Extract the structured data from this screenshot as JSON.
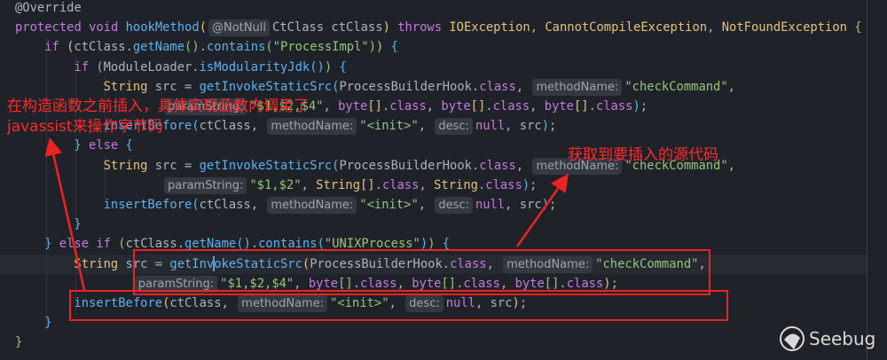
{
  "code_lines": [
    {
      "indent": 0,
      "tokens": [
        [
          "@Override",
          "ann"
        ]
      ]
    },
    {
      "indent": 0,
      "tokens": [
        [
          "protected void ",
          "kw"
        ],
        [
          "hookMethod",
          "fn"
        ],
        [
          "(",
          "p1"
        ],
        [
          "@NotNull",
          "hint"
        ],
        [
          "CtClass ctClass",
          ""
        ],
        [
          ")",
          "p1"
        ],
        [
          " throws ",
          "kw"
        ],
        [
          "IOException",
          "ty"
        ],
        [
          ", ",
          ""
        ],
        [
          "CannotCompileException",
          "ty"
        ],
        [
          ", ",
          ""
        ],
        [
          "NotFoundException",
          "ty"
        ],
        [
          " {",
          "p2"
        ]
      ]
    },
    {
      "indent": 4,
      "tokens": [
        [
          "if ",
          "kw"
        ],
        [
          "(",
          "p1"
        ],
        [
          "ctClass.",
          ""
        ],
        [
          "getName",
          "fn"
        ],
        [
          "()",
          "p2"
        ],
        [
          ".",
          ""
        ],
        [
          "contains",
          "fn"
        ],
        [
          "(",
          "p2"
        ],
        [
          "\"ProcessImpl\"",
          "str"
        ],
        [
          ")",
          "p2"
        ],
        [
          ")",
          "p1"
        ],
        [
          " {",
          "p3"
        ]
      ]
    },
    {
      "indent": 8,
      "tokens": [
        [
          "if ",
          "kw"
        ],
        [
          "(",
          "p2"
        ],
        [
          "ModuleLoader.",
          ""
        ],
        [
          "isModularityJdk",
          "fn"
        ],
        [
          "()",
          "p3"
        ],
        [
          ")",
          "p2"
        ],
        [
          " {",
          "p3"
        ]
      ]
    },
    {
      "indent": 12,
      "tokens": [
        [
          "String",
          "ty"
        ],
        [
          " src = ",
          ""
        ],
        [
          "getInvokeStaticSrc",
          "fn"
        ],
        [
          "(",
          "p3"
        ],
        [
          "ProcessBuilderHook.",
          ""
        ],
        [
          "class",
          "kw"
        ],
        [
          ", ",
          ""
        ],
        [
          "methodName:",
          "hint"
        ],
        [
          "\"checkCommand\"",
          "str"
        ],
        [
          ",",
          ""
        ]
      ]
    },
    {
      "indent": 20,
      "tokens": [
        [
          "paramString:",
          "hint"
        ],
        [
          "\"$1,$2,$4\"",
          "str"
        ],
        [
          ", ",
          ""
        ],
        [
          "byte",
          "kw"
        ],
        [
          "[]",
          "p1"
        ],
        [
          ".",
          ""
        ],
        [
          "class",
          "kw"
        ],
        [
          ", ",
          ""
        ],
        [
          "byte",
          "kw"
        ],
        [
          "[]",
          "p1"
        ],
        [
          ".",
          ""
        ],
        [
          "class",
          "kw"
        ],
        [
          ", ",
          ""
        ],
        [
          "byte",
          "kw"
        ],
        [
          "[]",
          "p1"
        ],
        [
          ".",
          ""
        ],
        [
          "class",
          "kw"
        ],
        [
          ")",
          "p3"
        ],
        [
          ";",
          ""
        ]
      ]
    },
    {
      "indent": 12,
      "tokens": [
        [
          "insertBefore",
          "fn"
        ],
        [
          "(",
          "p3"
        ],
        [
          "ctClass, ",
          ""
        ],
        [
          "methodName:",
          "hint"
        ],
        [
          "\"<init>\"",
          "str"
        ],
        [
          ", ",
          ""
        ],
        [
          "desc:",
          "hint"
        ],
        [
          "null",
          "kw"
        ],
        [
          ", src",
          ""
        ],
        [
          ")",
          "p3"
        ],
        [
          ";",
          ""
        ]
      ]
    },
    {
      "indent": 8,
      "tokens": [
        [
          "}",
          "p3"
        ],
        [
          " else ",
          "kw"
        ],
        [
          "{",
          "p3"
        ]
      ]
    },
    {
      "indent": 12,
      "tokens": [
        [
          "String",
          "ty"
        ],
        [
          " src = ",
          ""
        ],
        [
          "getInvokeStaticSrc",
          "fn"
        ],
        [
          "(",
          "p3"
        ],
        [
          "ProcessBuilderHook.",
          ""
        ],
        [
          "class",
          "kw"
        ],
        [
          ", ",
          ""
        ],
        [
          "methodName:",
          "hint"
        ],
        [
          "\"checkCommand\"",
          "str"
        ],
        [
          ",",
          ""
        ]
      ]
    },
    {
      "indent": 20,
      "tokens": [
        [
          "paramString:",
          "hint"
        ],
        [
          "\"$1,$2\"",
          "str"
        ],
        [
          ", ",
          ""
        ],
        [
          "String",
          "ty"
        ],
        [
          "[]",
          "p1"
        ],
        [
          ".",
          ""
        ],
        [
          "class",
          "kw"
        ],
        [
          ", ",
          ""
        ],
        [
          "String",
          "ty"
        ],
        [
          ".",
          ""
        ],
        [
          "class",
          "kw"
        ],
        [
          ")",
          "p3"
        ],
        [
          ";",
          ""
        ]
      ]
    },
    {
      "indent": 12,
      "tokens": [
        [
          "insertBefore",
          "fn"
        ],
        [
          "(",
          "p3"
        ],
        [
          "ctClass, ",
          ""
        ],
        [
          "methodName:",
          "hint"
        ],
        [
          "\"<init>\"",
          "str"
        ],
        [
          ", ",
          ""
        ],
        [
          "desc:",
          "hint"
        ],
        [
          "null",
          "kw"
        ],
        [
          ", src",
          ""
        ],
        [
          ")",
          "p3"
        ],
        [
          ";",
          ""
        ]
      ]
    },
    {
      "indent": 8,
      "tokens": [
        [
          "}",
          "p3"
        ]
      ]
    },
    {
      "indent": 4,
      "tokens": [
        [
          "}",
          "p3"
        ],
        [
          " else if ",
          "kw"
        ],
        [
          "(",
          "p2"
        ],
        [
          "ctClass.",
          ""
        ],
        [
          "getName",
          "fn"
        ],
        [
          "()",
          "p3"
        ],
        [
          ".",
          ""
        ],
        [
          "contains",
          "fn"
        ],
        [
          "(",
          "p3"
        ],
        [
          "\"UNIXProcess\"",
          "str"
        ],
        [
          ")",
          "p3"
        ],
        [
          ")",
          "p2"
        ],
        [
          " {",
          "p3"
        ]
      ]
    },
    {
      "indent": 8,
      "tokens": [
        [
          "String",
          "ty"
        ],
        [
          " src = ",
          ""
        ],
        [
          "getInv",
          "fn"
        ],
        [
          "|caret",
          "caret"
        ],
        [
          "okeStaticSrc",
          "fn"
        ],
        [
          "(",
          "p1"
        ],
        [
          "ProcessBuilderHook.",
          ""
        ],
        [
          "class",
          "kw"
        ],
        [
          ", ",
          ""
        ],
        [
          "methodName:",
          "hint"
        ],
        [
          "\"checkCommand\"",
          "str"
        ],
        [
          ",",
          ""
        ]
      ]
    },
    {
      "indent": 16,
      "tokens": [
        [
          "paramString:",
          "hint"
        ],
        [
          "\"$1,$2,$4\"",
          "str"
        ],
        [
          ", ",
          ""
        ],
        [
          "byte",
          "kw"
        ],
        [
          "[]",
          "p2"
        ],
        [
          ".",
          ""
        ],
        [
          "class",
          "kw"
        ],
        [
          ", ",
          ""
        ],
        [
          "byte",
          "kw"
        ],
        [
          "[]",
          "p2"
        ],
        [
          ".",
          ""
        ],
        [
          "class",
          "kw"
        ],
        [
          ", ",
          ""
        ],
        [
          "byte",
          "kw"
        ],
        [
          "[]",
          "p2"
        ],
        [
          ".",
          ""
        ],
        [
          "class",
          "kw"
        ],
        [
          ")",
          "p1"
        ],
        [
          ";",
          ""
        ]
      ]
    },
    {
      "indent": 8,
      "tokens": [
        [
          "insertBefore",
          "fn"
        ],
        [
          "(",
          "p1"
        ],
        [
          "ctClass, ",
          ""
        ],
        [
          "methodName:",
          "hint"
        ],
        [
          "\"<init>\"",
          "str"
        ],
        [
          ", ",
          ""
        ],
        [
          "desc:",
          "hint"
        ],
        [
          "null",
          "kw"
        ],
        [
          ", src",
          ""
        ],
        [
          ")",
          "p1"
        ],
        [
          ";",
          ""
        ]
      ]
    },
    {
      "indent": 4,
      "tokens": [
        [
          "}",
          "p3"
        ]
      ]
    },
    {
      "indent": 0,
      "tokens": [
        [
          "}",
          "p2"
        ]
      ]
    }
  ],
  "annotations": {
    "note_left_line1": "在构造函数之前插入，具体实现函数内调用了",
    "note_left_line2": "javassist来操作字节码",
    "note_right": "获取到要插入的源代码"
  },
  "watermark": {
    "text": "Seebug"
  },
  "colors": {
    "background": "#1f2329",
    "annotation_red": "#ff2a2a"
  }
}
